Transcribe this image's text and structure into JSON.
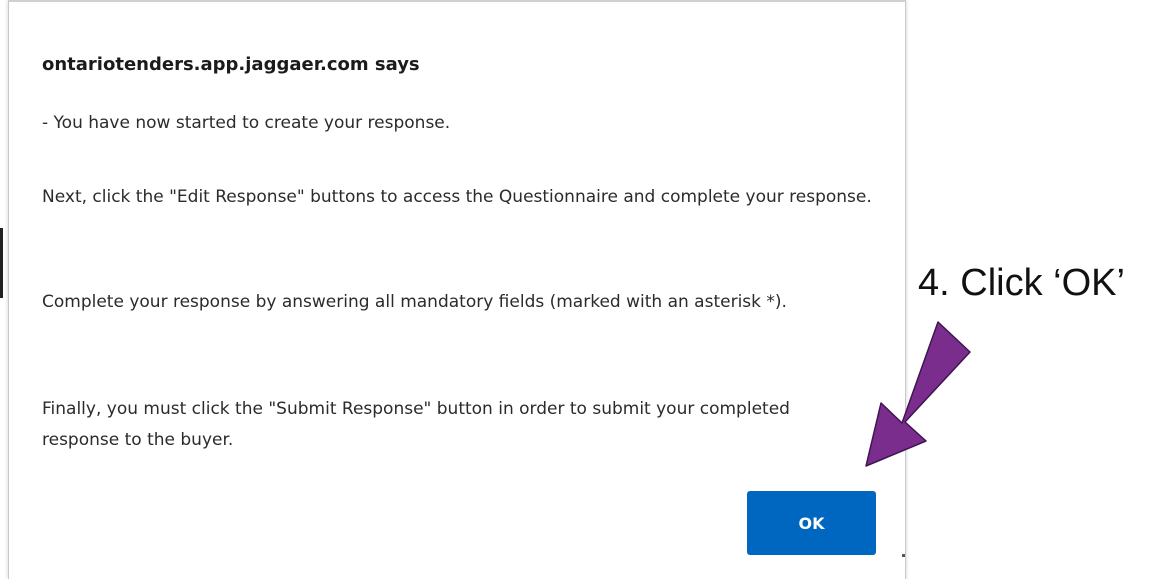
{
  "dialog": {
    "title": "ontariotenders.app.jaggaer.com says",
    "messages": [
      "- You have now started to create your response.",
      "Next, click the \"Edit Response\" buttons to access the Questionnaire and complete your response.",
      "Complete your response by answering all mandatory fields (marked with an asterisk *).",
      "Finally, you must click the \"Submit Response\" button in order to submit your completed response to the buyer."
    ],
    "ok_label": "OK"
  },
  "annotation": {
    "text": "4. Click ‘OK’",
    "arrow_icon": "arrow-down-left-icon",
    "arrow_color": "#7b2d8e"
  },
  "colors": {
    "button_bg": "#0067c0",
    "button_text": "#ffffff",
    "arrow": "#7b2d8e"
  }
}
